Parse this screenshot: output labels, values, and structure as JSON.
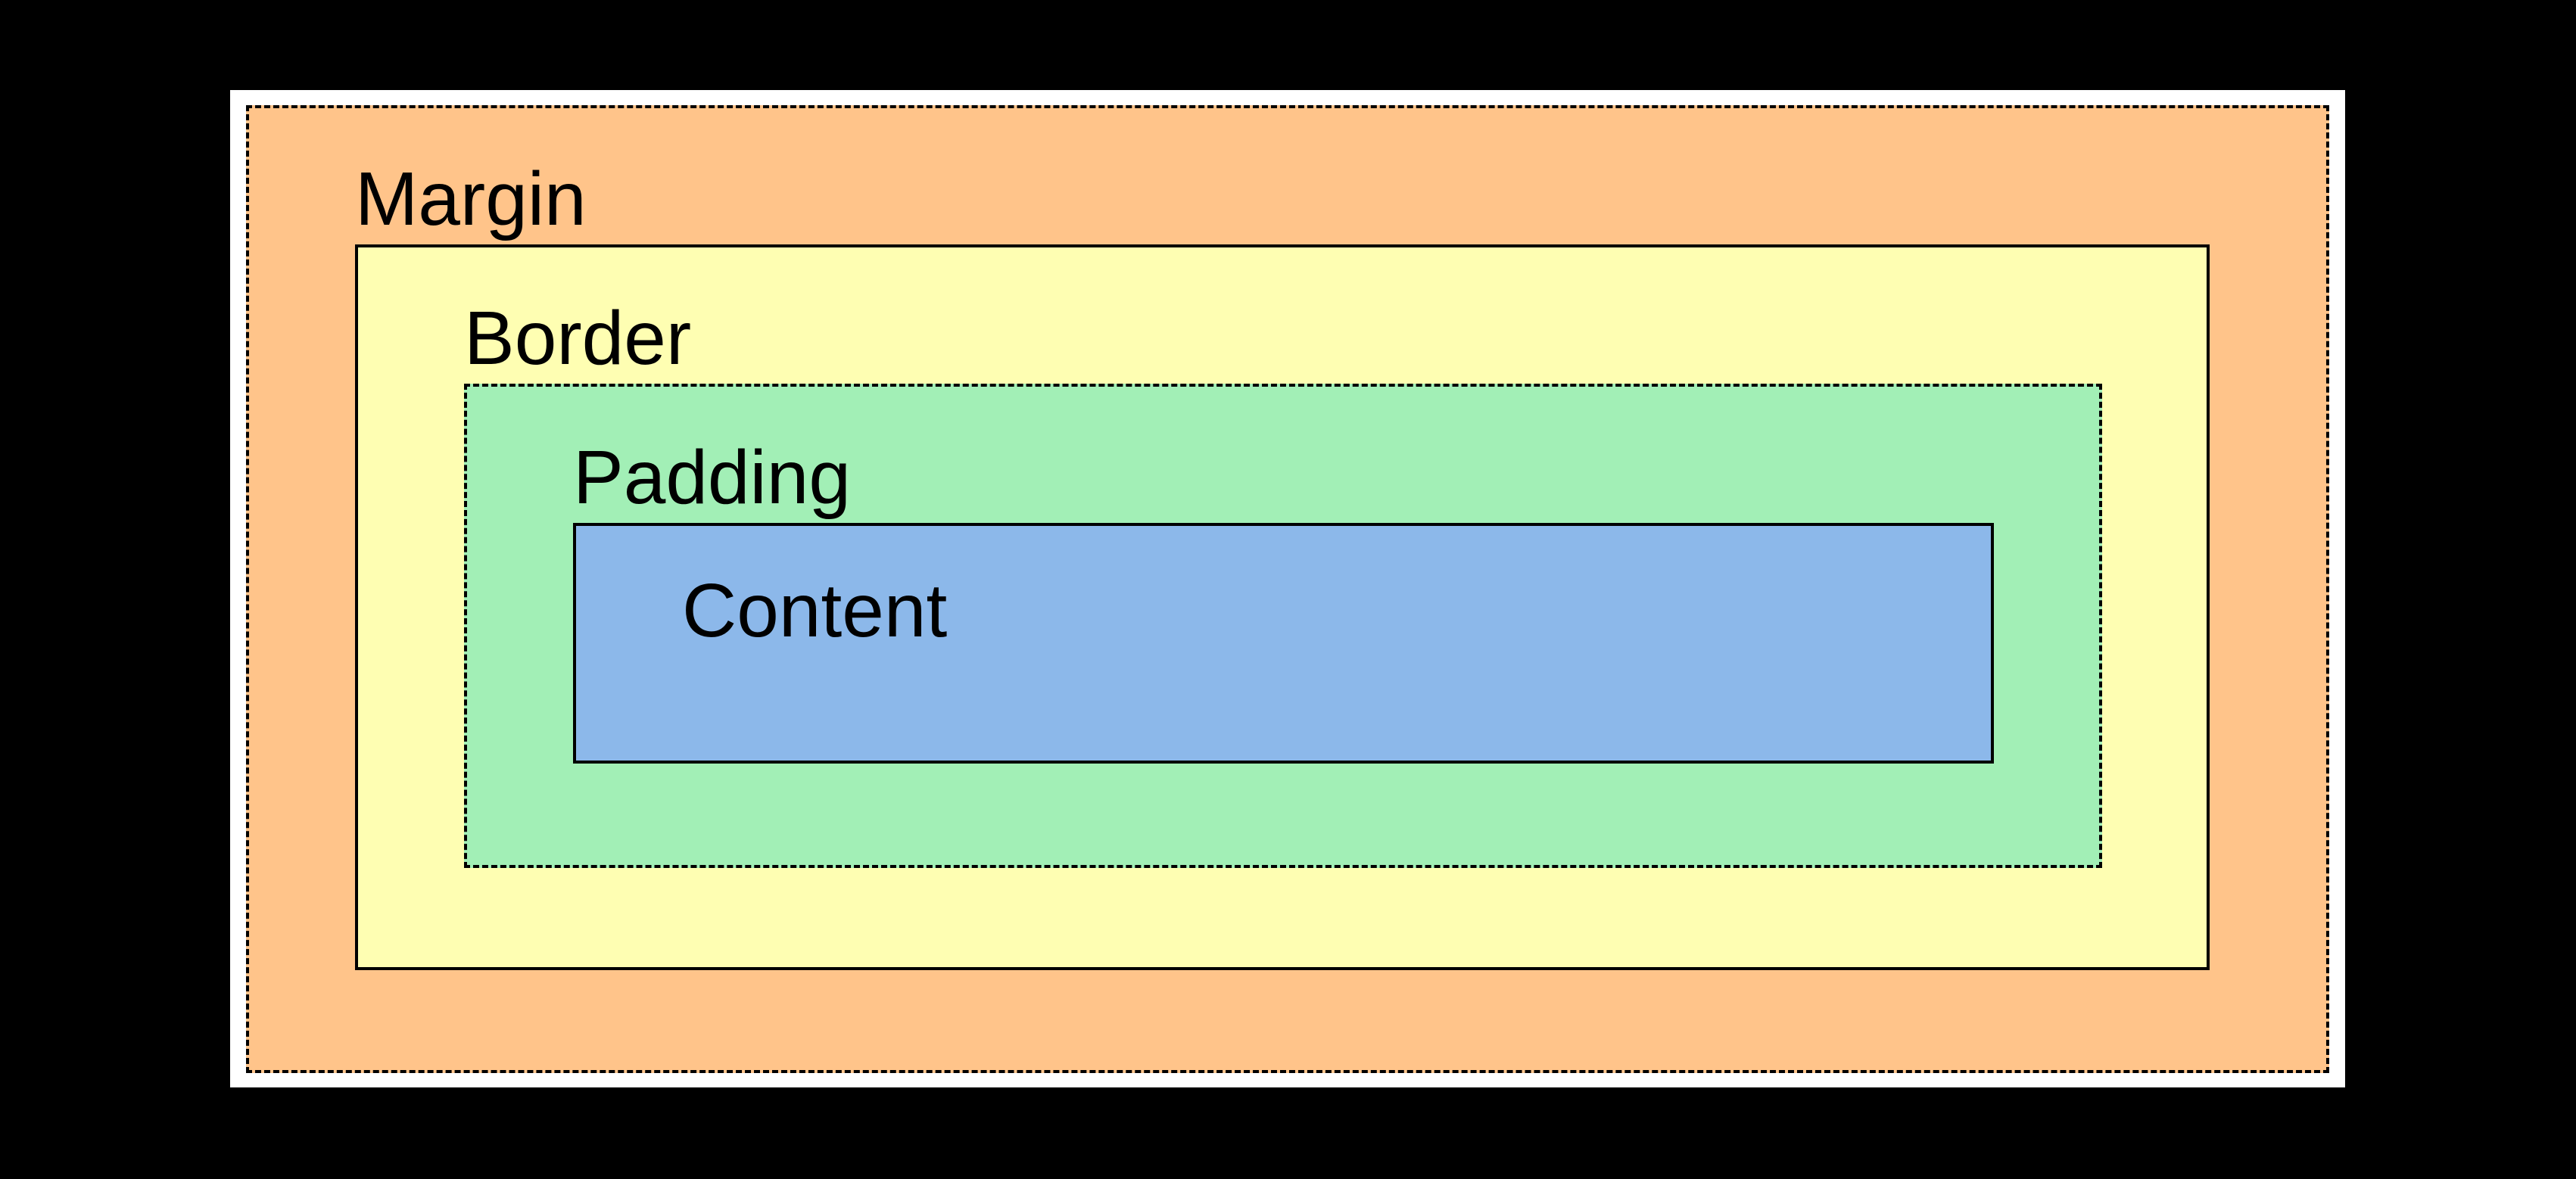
{
  "diagram": {
    "layers": {
      "margin": {
        "label": "Margin",
        "color": "#ffc48a"
      },
      "border": {
        "label": "Border",
        "color": "#fefeb2"
      },
      "padding": {
        "label": "Padding",
        "color": "#a2efb6"
      },
      "content": {
        "label": "Content",
        "color": "#8cb8ea"
      }
    },
    "background_color": "#000000",
    "frame_color": "#ffffff",
    "outline_color": "#000000"
  }
}
